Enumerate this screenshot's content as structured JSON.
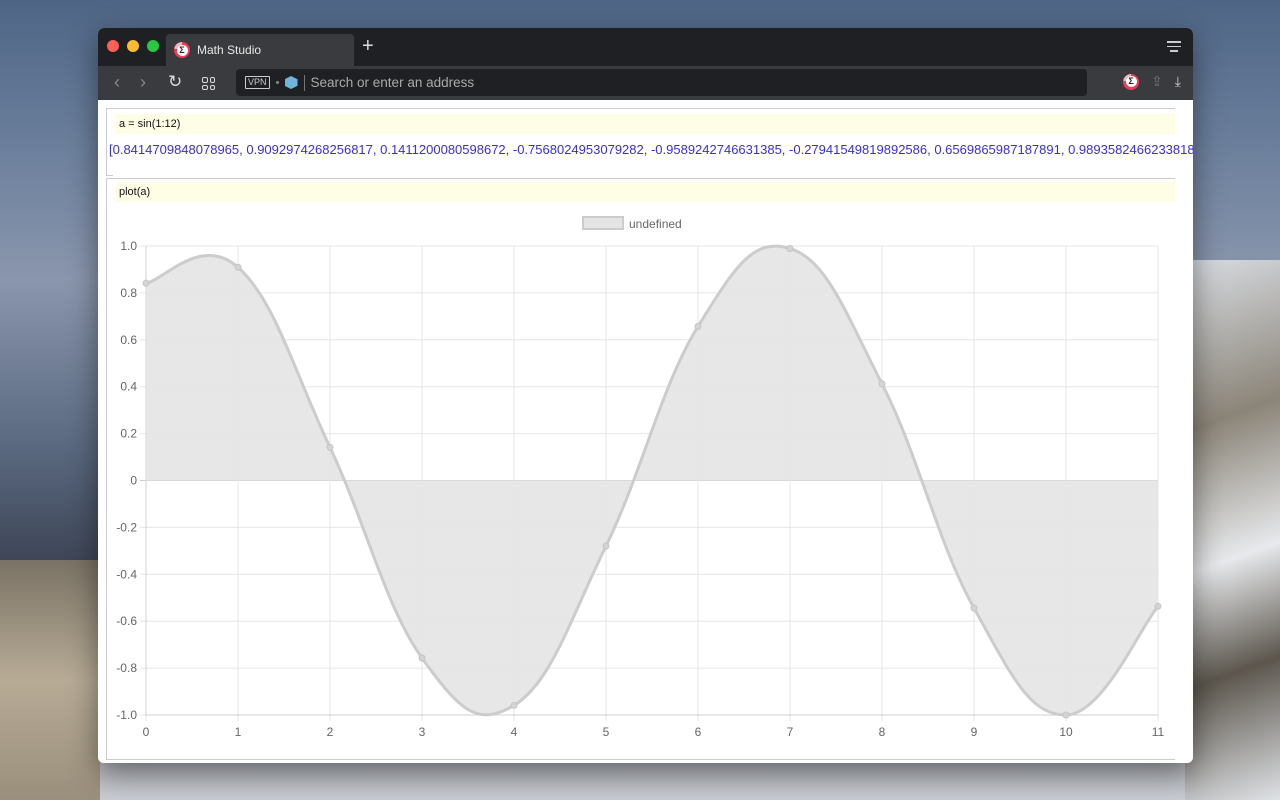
{
  "browser": {
    "tab_title": "Math Studio",
    "new_tab_label": "+",
    "address_placeholder": "Search or enter an address",
    "vpn_label": "VPN",
    "icons": [
      "sigma-app-icon",
      "back-icon",
      "forward-icon",
      "reload-icon",
      "tabs-grid-icon",
      "vpn-badge",
      "cube-extension-icon",
      "sigma-extension-icon",
      "share-icon",
      "download-icon",
      "menu-icon"
    ]
  },
  "notebook": {
    "cells": [
      {
        "input": "a = sin(1:12)",
        "output": "[0.8414709848078965, 0.9092974268256817, 0.1411200080598672, -0.7568024953079282, -0.9589242746631385, -0.27941549819892586, 0.6569865987187891, 0.9893582466233818"
      },
      {
        "input": "plot(a)"
      }
    ]
  },
  "chart_data": {
    "type": "area",
    "title": "",
    "xlabel": "",
    "ylabel": "",
    "legend": {
      "entries": [
        "undefined"
      ],
      "placement": "top-center"
    },
    "x": [
      0,
      1,
      2,
      3,
      4,
      5,
      6,
      7,
      8,
      9,
      10,
      11
    ],
    "series": [
      {
        "name": "undefined",
        "values": [
          0.8414709848078965,
          0.9092974268256817,
          0.1411200080598672,
          -0.7568024953079282,
          -0.9589242746631385,
          -0.27941549819892586,
          0.6569865987187891,
          0.9893582466233818,
          0.4121184852417566,
          -0.5440211108893698,
          -0.9999902065507035,
          -0.5365729180004349
        ],
        "color": "#cccccc",
        "fill": "#e4e4e4"
      }
    ],
    "xlim": [
      0,
      11
    ],
    "ylim": [
      -1.0,
      1.0
    ],
    "yticks": [
      "1.0",
      "0.8",
      "0.6",
      "0.4",
      "0.2",
      "0",
      "-0.2",
      "-0.4",
      "-0.6",
      "-0.8",
      "-1.0"
    ],
    "xticks": [
      "0",
      "1",
      "2",
      "3",
      "4",
      "5",
      "6",
      "7",
      "8",
      "9",
      "10",
      "11"
    ],
    "grid": true
  }
}
